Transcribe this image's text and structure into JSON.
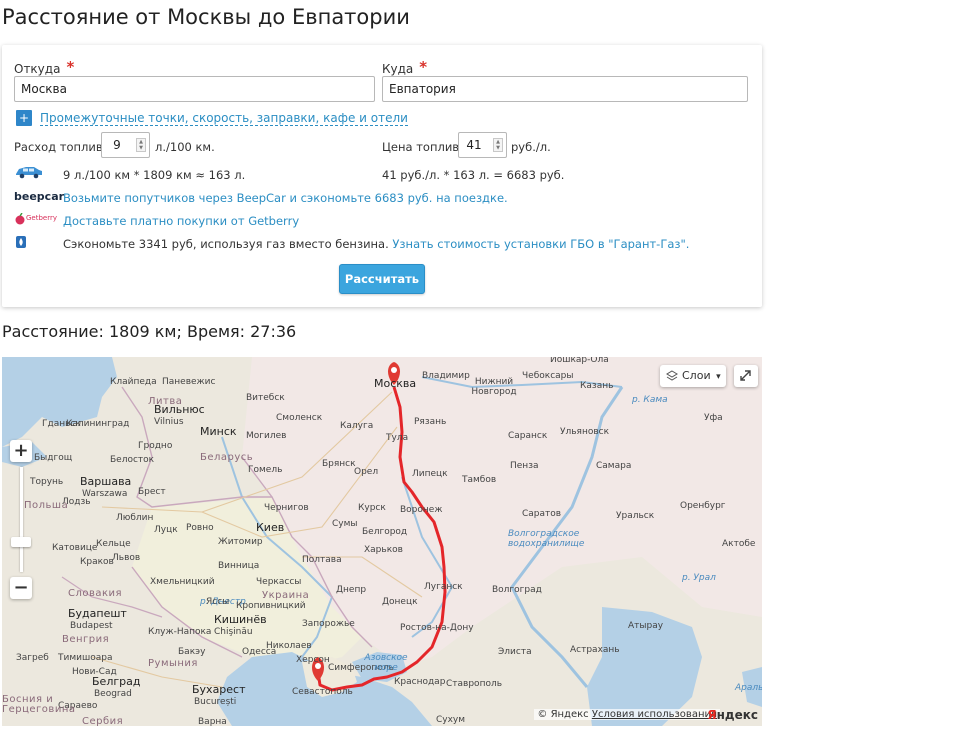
{
  "page": {
    "title": "Расстояние от Москвы до Евпатории"
  },
  "form": {
    "from_label": "Откуда",
    "from_value": "Москва",
    "to_label": "Куда",
    "to_value": "Евпатория",
    "required_mark": "*",
    "extra_link": "Промежуточные точки, скорость, заправки, кафе и отели",
    "plus_symbol": "+",
    "consumption_label": "Расход топлива",
    "consumption_value": "9",
    "consumption_unit": "л./100 км.",
    "price_label": "Цена топлива",
    "price_value": "41",
    "price_unit": "руб./л.",
    "calc_line_1": "9 л./100 км * 1809 км ≈ 163 л.",
    "calc_line_2": "41 руб./л. * 163 л. = 6683 руб.",
    "beepcar_brand": "beepcar",
    "beepcar_link": "Возьмите попутчиков через BeepCar и сэкономьте 6683 руб. на поездке.",
    "getberry_brand": "Getberry",
    "getberry_link": "Доставьте платно покупки от Getberry",
    "gas_text": "Сэкономьте 3341 руб, используя газ вместо бензина.",
    "gas_link": "Узнать стоимость установки ГБО в \"Гарант-Газ\".",
    "calc_button": "Рассчитать"
  },
  "result": {
    "text": "Расстояние: 1809 км; Время: 27:36"
  },
  "map": {
    "layers_label": "Слои",
    "zoom_in": "+",
    "zoom_out": "−",
    "copyright": "© Яндекс",
    "terms": "Условия использования",
    "logo_main": "Я",
    "logo_rest": "ндекс",
    "colors": {
      "route": "#e4262a",
      "water": "#b4d0e6",
      "land": "#ede9df",
      "marker": "#e03a33"
    },
    "labels": {
      "moskva": "Москва",
      "vladimir": "Владимир",
      "nizhny": "Нижний Новгород",
      "cheboksary": "Чебоксары",
      "yoshkar": "Йошкар-Ола",
      "kazan": "Казань",
      "kaluga": "Калуга",
      "ryazan": "Рязань",
      "tula": "Тула",
      "saransk": "Саранск",
      "ulyanovsk": "Ульяновск",
      "ufa": "Уфа",
      "bryansk": "Брянск",
      "orel": "Орел",
      "lipetsk": "Липецк",
      "tambov": "Тамбов",
      "penza": "Пенза",
      "samara": "Самара",
      "kursk": "Курск",
      "voronezh": "Воронеж",
      "saratov": "Саратов",
      "orenburg": "Оренбург",
      "belgorod": "Белгород",
      "kharkov": "Харьков",
      "lugansk": "Луганск",
      "volgograd": "Волгоград",
      "donetsk": "Донецк",
      "rostov": "Ростов-на-Дону",
      "elista": "Элиста",
      "astrakhan": "Астрахань",
      "atyrau": "Атырау",
      "aktobe": "Актобе",
      "uralsk": "Уральск",
      "krasnodar": "Краснодар",
      "stavropol": "Ставрополь",
      "sukhum": "Сухум",
      "sevastopol": "Севастополь",
      "simferopol": "Симферополь",
      "kiev": "Киев",
      "minsk": "Минск",
      "belarus": "Беларусь",
      "ukraina": "Украина",
      "smolensk": "Смоленск",
      "vitebsk": "Витебск",
      "mogilev": "Могилев",
      "gomel": "Гомель",
      "chernigov": "Чернигов",
      "sumy": "Сумы",
      "poltava": "Полтава",
      "dnepr": "Днепр",
      "zaporozhye": "Запорожье",
      "nikolaev": "Николаев",
      "kherson": "Херсон",
      "odessa": "Одесса",
      "kishinev": "Кишинёв",
      "chisinau": "Chişinău",
      "litva": "Литва",
      "vilnius": "Вильнюс",
      "vilnius_lat": "Vilnius",
      "kaliningrad": "Калининград",
      "varshava": "Варшава",
      "warszawa": "Warszawa",
      "polsha": "Польша",
      "lodz": "Лодзь",
      "lublin": "Люблин",
      "brest": "Брест",
      "grodno": "Гродно",
      "rumynia": "Румыния",
      "bucharest": "Бухарест",
      "bucuresti": "București",
      "slovakia": "Словакия",
      "budapest": "Будапешт",
      "budapest_lat": "Budapest",
      "vengriya": "Венгрия",
      "belgrad": "Белград",
      "beograd": "Beograd",
      "serbia": "Сербия",
      "sarajevo": "Сараево",
      "zagreb": "Загреб",
      "bosnia": "Босния и Герцеговина",
      "varna": "Варна",
      "azov": "Азовское море",
      "volgograd_res": "Волгоградское водохранилище",
      "ural_river": "р. Урал",
      "kama": "р. Кама",
      "dnestr": "р. Днестр",
      "aral": "Аральское",
      "klaipeda": "Клайпеда",
      "panevezys": "Паневежис",
      "gdansk": "Гданьск",
      "bydgoszcz": "Быдгощ",
      "bialystok": "Белосток",
      "torun": "Торунь",
      "lutsk": "Луцк",
      "rovno": "Ровно",
      "zhitomir": "Житомир",
      "vinnitsa": "Винница",
      "cherkassy": "Черкассы",
      "kirovograd": "Кропивницкий",
      "khmelnitsky": "Хмельницкий",
      "lvov": "Львов",
      "katowice": "Катовице",
      "kielce": "Кельце",
      "krakow": "Краков",
      "cluj": "Клуж-Напока",
      "timisoara": "Тимишоара",
      "iasi": "Яссы",
      "novi_sad": "Нови-Сад",
      "bacau": "Бакэу"
    }
  }
}
